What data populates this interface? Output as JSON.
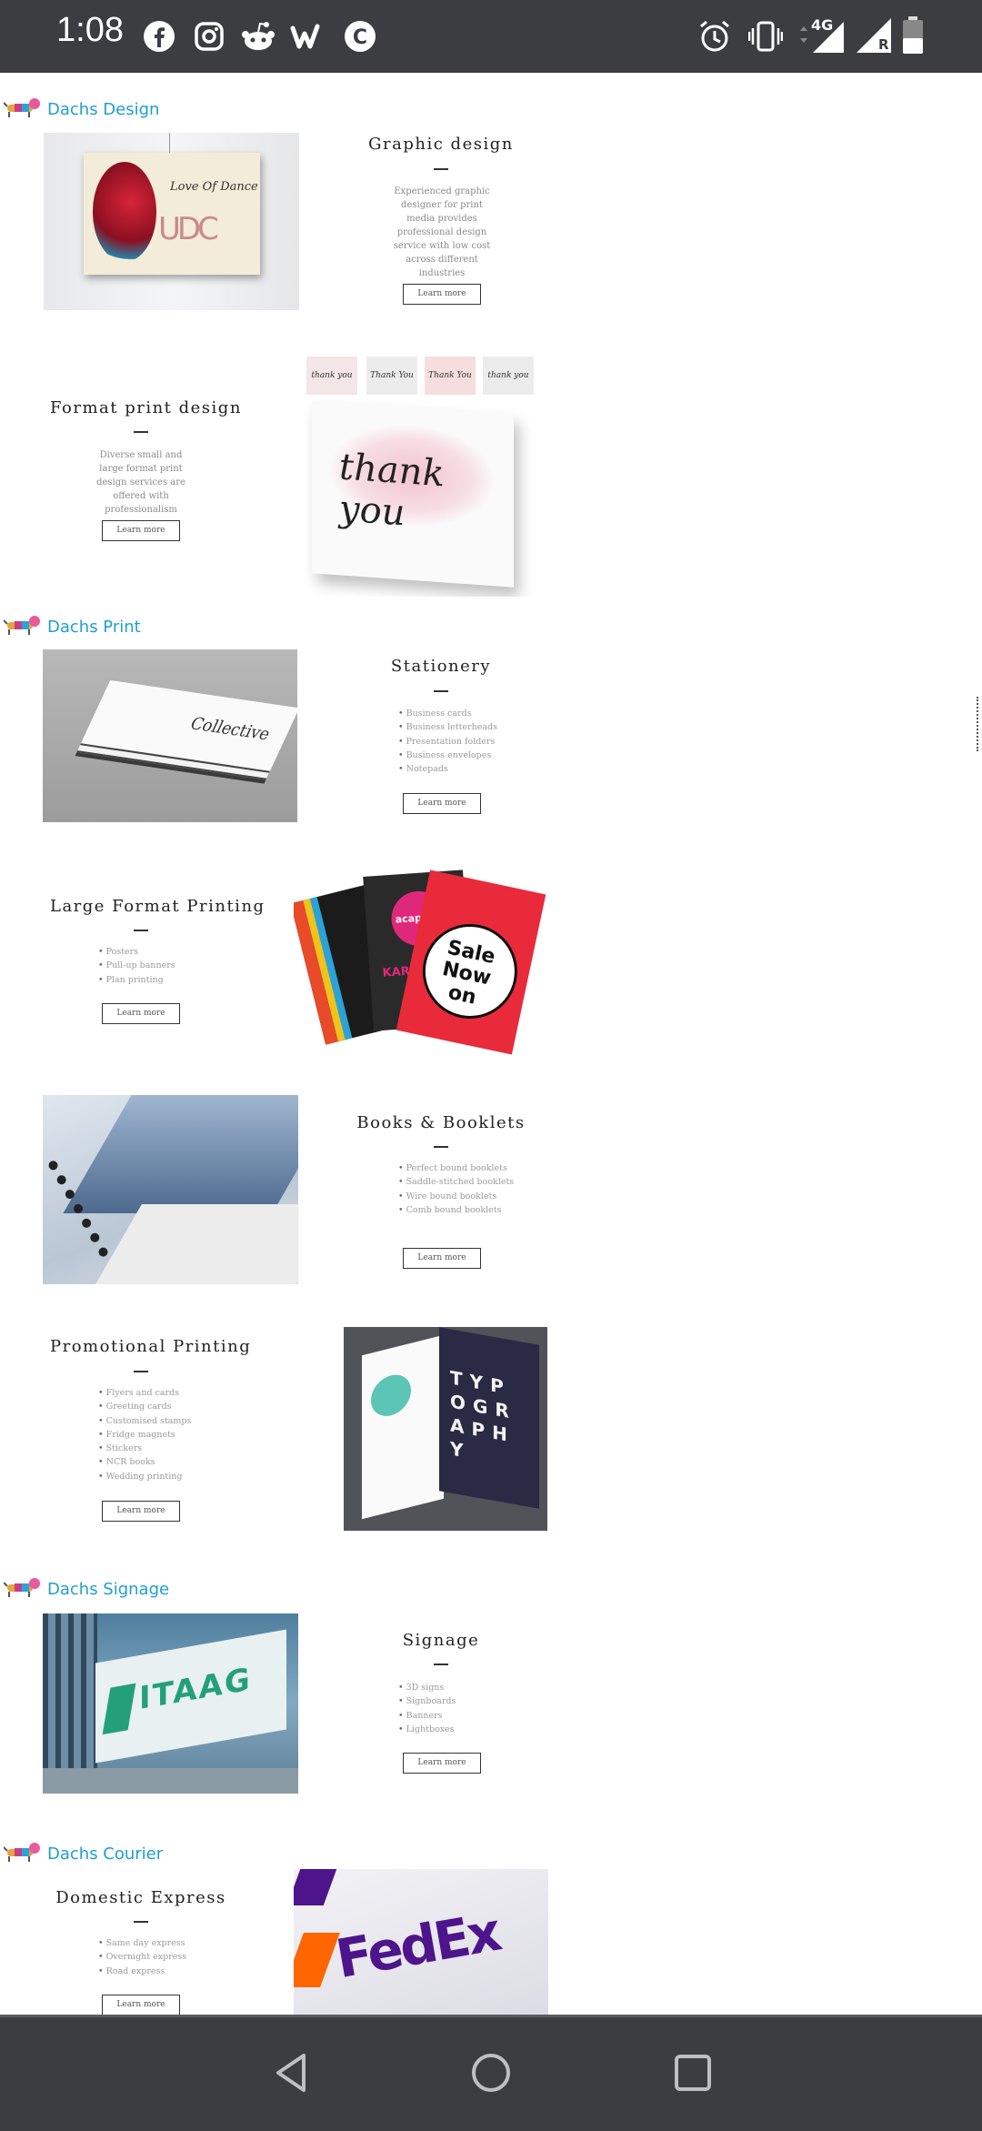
{
  "status_bar": {
    "time": "1:08",
    "left_icons": [
      "facebook-icon",
      "instagram-icon",
      "reddit-icon",
      "wattpad-icon",
      "copyright-app-icon"
    ],
    "right_icons": [
      "alarm-icon",
      "vibrate-icon",
      "signal-4g-icon",
      "signal-roaming-icon",
      "battery-icon"
    ],
    "network_label": "4G",
    "roaming_label": "R"
  },
  "sections": {
    "design": "Dachs Design",
    "print": "Dachs Print",
    "signage": "Dachs Signage",
    "courier": "Dachs Courier"
  },
  "cards": {
    "graphic": {
      "title": "Graphic design",
      "description": "Experienced graphic designer for print media provides professional design service with low cost across different industries",
      "button": "Learn more",
      "image_text": "Love Of Dance"
    },
    "format": {
      "title": "Format print design",
      "description": "Diverse small and large format print design services are offered with professionalism",
      "button": "Learn more",
      "image_text": "thank you"
    },
    "stationery": {
      "title": "Stationery",
      "items": [
        "Business cards",
        "Business letterheads",
        "Presentation folders",
        "Business envelopes",
        "Notepads"
      ],
      "button": "Learn more",
      "image_text": "Collective"
    },
    "large": {
      "title": "Large Format Printing",
      "items": [
        "Posters",
        "Pull-up banners",
        "Plan printing"
      ],
      "button": "Learn more",
      "image_text": "Sale Now on"
    },
    "books": {
      "title": "Books & Booklets",
      "items": [
        "Perfect bound booklets",
        "Saddle-stitched booklets",
        "Wire bound booklets",
        "Comb bound booklets"
      ],
      "button": "Learn more"
    },
    "promo": {
      "title": "Promotional Printing",
      "items": [
        "Flyers and cards",
        "Greeting cards",
        "Customised stamps",
        "Fridge magnets",
        "Stickers",
        "NCR books",
        "Wedding printing"
      ],
      "button": "Learn more",
      "image_text": "TYPOGRAPHY"
    },
    "signage": {
      "title": "Signage",
      "items": [
        "3D signs",
        "Signboards",
        "Banners",
        "Lightboxes"
      ],
      "button": "Learn more",
      "image_text": "ITAAG"
    },
    "domestic": {
      "title": "Domestic Express",
      "items": [
        "Same day express",
        "Overnight express",
        "Road express"
      ],
      "button": "Learn more",
      "image_text": "FedEx"
    }
  },
  "colors": {
    "brand_blue": "#1f9ecf",
    "status_bar_bg": "#3b3d41",
    "nav_bar_bg": "#3b3d41"
  }
}
